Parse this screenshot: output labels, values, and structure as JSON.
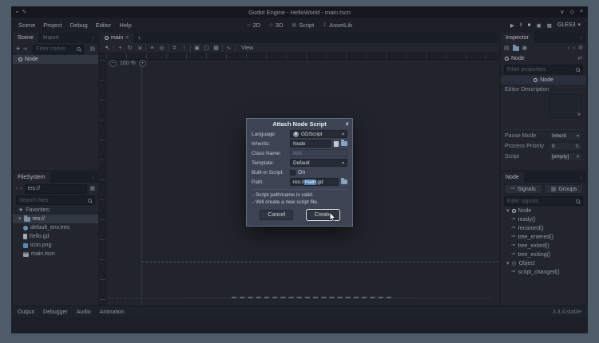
{
  "window": {
    "title": "Godot Engine - HelloWorld - main.tscn"
  },
  "icons": {
    "app": "▪",
    "pencil": "✎",
    "win_min": "∨",
    "win_max": "◇",
    "win_close": "×",
    "menu_dots": "⋮",
    "dropdown": "▾",
    "chev_left": "‹",
    "chev_right": "›",
    "close": "×",
    "plus": "+",
    "minus": "−",
    "star": "★",
    "collapse": "▾",
    "signal": "⇒",
    "play": "▶",
    "pause": "‖",
    "stop": "■",
    "clapper": "▣",
    "clapper2": "▦",
    "ws_2d": "▱",
    "ws_3d": "◇",
    "ws_script": "▤",
    "ws_assetlib": "↧",
    "select": "↖",
    "move": "+",
    "rotate": "↻",
    "scale": "⇲",
    "list": "≡",
    "pivot": "◎",
    "lock": "▣",
    "unlock": "▢",
    "group": "▦",
    "ungroup": "▧",
    "skeleton": "∿",
    "snap": "#",
    "gear": "⚙",
    "spin": "⇅",
    "expand": "⇲",
    "link": "∞",
    "grid": "▦",
    "page": "▤",
    "save": "▣",
    "history": "⇄",
    "gd": "GD"
  },
  "menubar": {
    "items": [
      "Scene",
      "Project",
      "Debug",
      "Editor",
      "Help"
    ]
  },
  "workspaces": {
    "items": [
      "2D",
      "3D",
      "Script",
      "AssetLib"
    ]
  },
  "playbar": {
    "renderer": "GLES3"
  },
  "scene_panel": {
    "tab_scene": "Scene",
    "tab_import": "Import",
    "filter_placeholder": "Filter nodes",
    "root_node": "Node"
  },
  "filesystem": {
    "tab": "FileSystem",
    "path": "res://",
    "search_placeholder": "Search files",
    "favorites": "Favorites:",
    "root": "res://",
    "files": [
      "default_env.tres",
      "hello.gd",
      "icon.png",
      "main.tscn"
    ]
  },
  "canvas": {
    "tab": "main",
    "view": "View",
    "zoom_out": "−",
    "zoom_value": "100 %",
    "zoom_in": "+"
  },
  "inspector": {
    "tab": "Inspector",
    "object_name": "Node",
    "filter_placeholder": "Filter properties",
    "category": "Node",
    "editor_description": "Editor Description",
    "pause_mode": "Pause Mode",
    "pause_mode_value": "Inherit",
    "process_priority": "Process Priority",
    "process_priority_value": "0",
    "script": "Script",
    "script_value": "[empty]"
  },
  "node_panel": {
    "tab": "Node",
    "signals_button": "Signals",
    "groups_button": "Groups",
    "filter_placeholder": "Filter signals",
    "node_group": "Node",
    "node_signals": [
      "ready()",
      "renamed()",
      "tree_entered()",
      "tree_exited()",
      "tree_exiting()"
    ],
    "object_group": "Object",
    "object_signals": [
      "script_changed()"
    ]
  },
  "bottom_bar": {
    "tabs": [
      "Output",
      "Debugger",
      "Audio",
      "Animation"
    ],
    "version": "3.3.4.stable"
  },
  "dialog": {
    "title": "Attach Node Script",
    "language_label": "Language:",
    "language_value": "GDScript",
    "inherits_label": "Inherits:",
    "inherits_value": "Node",
    "class_label": "Class Name:",
    "class_value": "N/A",
    "template_label": "Template:",
    "template_value": "Default",
    "builtin_label": "Built-in Script:",
    "builtin_value": "On",
    "path_label": "Path:",
    "path_prefix": "res://",
    "path_selected": "main",
    "path_suffix": ".gd",
    "messages": [
      "- Script path/name is valid.",
      "- Will create a new script file."
    ],
    "cancel": "Cancel",
    "create": "Create"
  }
}
